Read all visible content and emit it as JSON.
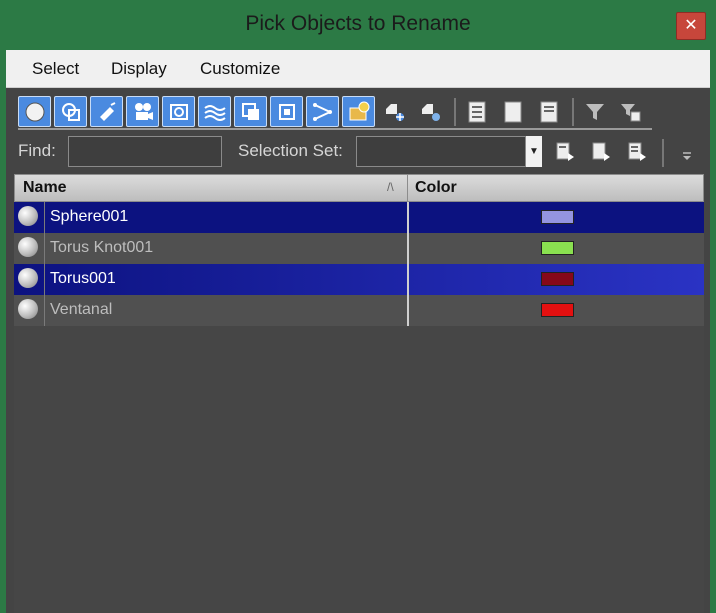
{
  "window": {
    "title": "Pick Objects to Rename",
    "close_label": "✕"
  },
  "menu": [
    "Select",
    "Display",
    "Customize"
  ],
  "toolbar": {
    "filter_buttons": [
      "geometry-icon",
      "shapes-icon",
      "lights-icon",
      "cameras-icon",
      "helpers-icon",
      "space-warps-icon",
      "groups-icon",
      "xrefs-icon",
      "bones-icon",
      "containers-icon",
      "frozen-objects-icon",
      "hidden-objects-icon"
    ],
    "selection_buttons": [
      "select-all-icon",
      "select-none-icon",
      "select-invert-icon"
    ],
    "filter_tools": [
      "filter-icon",
      "filter-options-icon"
    ]
  },
  "find": {
    "label": "Find:",
    "value": ""
  },
  "selection_set": {
    "label": "Selection Set:",
    "value": ""
  },
  "list": {
    "columns": {
      "name": "Name",
      "color": "Color",
      "sort_indicator": "/\\"
    },
    "rows": [
      {
        "name": "Sphere001",
        "color": "#9494e0",
        "selected": true
      },
      {
        "name": "Torus Knot001",
        "color": "#8ae050",
        "selected": false
      },
      {
        "name": "Torus001",
        "color": "#86081a",
        "selected": true
      },
      {
        "name": "Ventanal",
        "color": "#e41010",
        "selected": false
      }
    ]
  },
  "colors": {
    "title_bar": "#2c7a45",
    "selected_row": "#0c1280",
    "toolbar_active": "#4a8ae0"
  }
}
